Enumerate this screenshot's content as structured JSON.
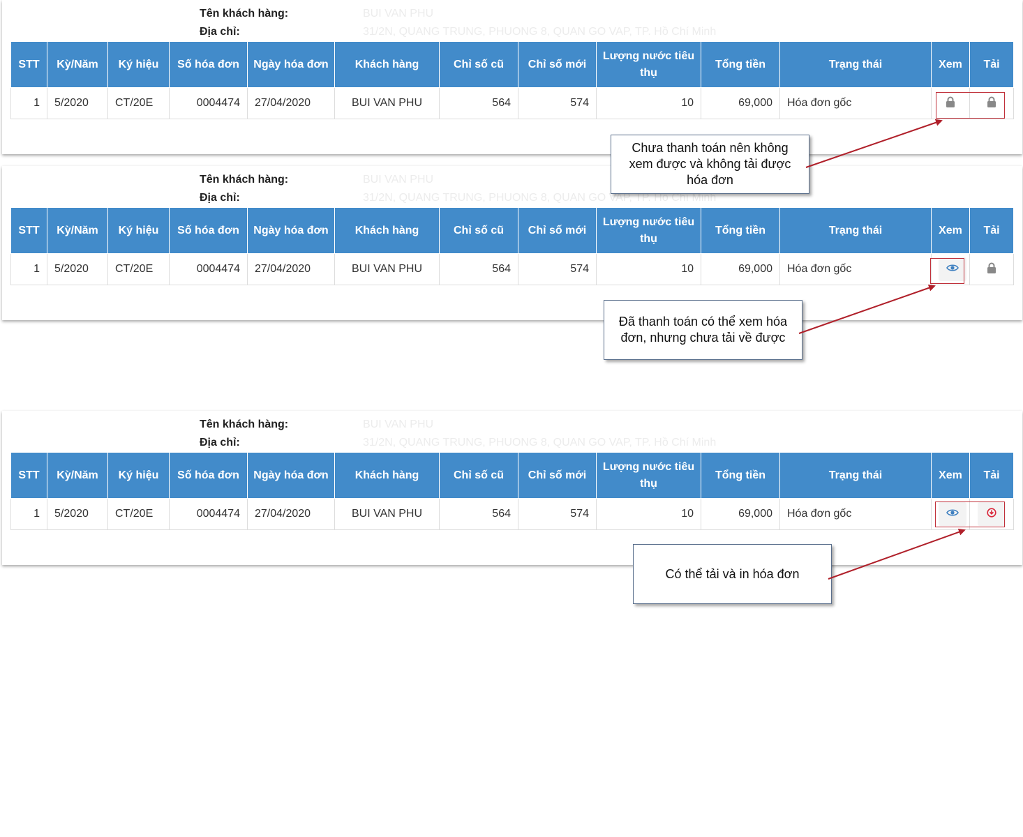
{
  "labels": {
    "customer_name": "Tên khách hàng:",
    "address": "Địa chỉ:"
  },
  "customer": {
    "name": "BUI VAN PHU",
    "address": "31/2N, QUANG TRUNG, PHUONG 8, QUAN GO VAP, TP. Hồ Chí Minh"
  },
  "table": {
    "headers": {
      "stt": "STT",
      "ky_nam": "Kỳ/Năm",
      "ky_hieu": "Ký hiệu",
      "so_hoa_don": "Số hóa đơn",
      "ngay_hoa_don": "Ngày hóa đơn",
      "khach_hang": "Khách hàng",
      "chi_so_cu": "Chỉ số cũ",
      "chi_so_moi": "Chỉ số mới",
      "luong_nuoc": "Lượng nước tiêu thụ",
      "tong_tien": "Tổng tiền",
      "trang_thai": "Trạng thái",
      "xem": "Xem",
      "tai": "Tải"
    },
    "row": {
      "stt": "1",
      "ky_nam": "5/2020",
      "ky_hieu": "CT/20E",
      "so_hoa_don": "0004474",
      "ngay_hoa_don": "27/04/2020",
      "khach_hang": "BUI VAN PHU",
      "chi_so_cu": "564",
      "chi_so_moi": "574",
      "luong_nuoc": "10",
      "tong_tien": "69,000",
      "trang_thai": "Hóa đơn gốc"
    }
  },
  "callouts": {
    "unpaid": "Chưa thanh toán nên không xem được và không tải được hóa đơn",
    "paid_view_only": "Đã thanh toán có thể xem hóa đơn, nhưng chưa tải về được",
    "downloadable": "Có thể tải và in hóa đơn"
  },
  "colors": {
    "header_bg": "#428bca",
    "highlight_border": "#c0303a",
    "arrow": "#b0202a",
    "view_icon": "#3d7fc0",
    "download_icon": "#d9263a",
    "lock_icon": "#888888"
  },
  "icons": {
    "locked": "lock-icon",
    "view": "eye-icon",
    "download": "download-icon"
  }
}
